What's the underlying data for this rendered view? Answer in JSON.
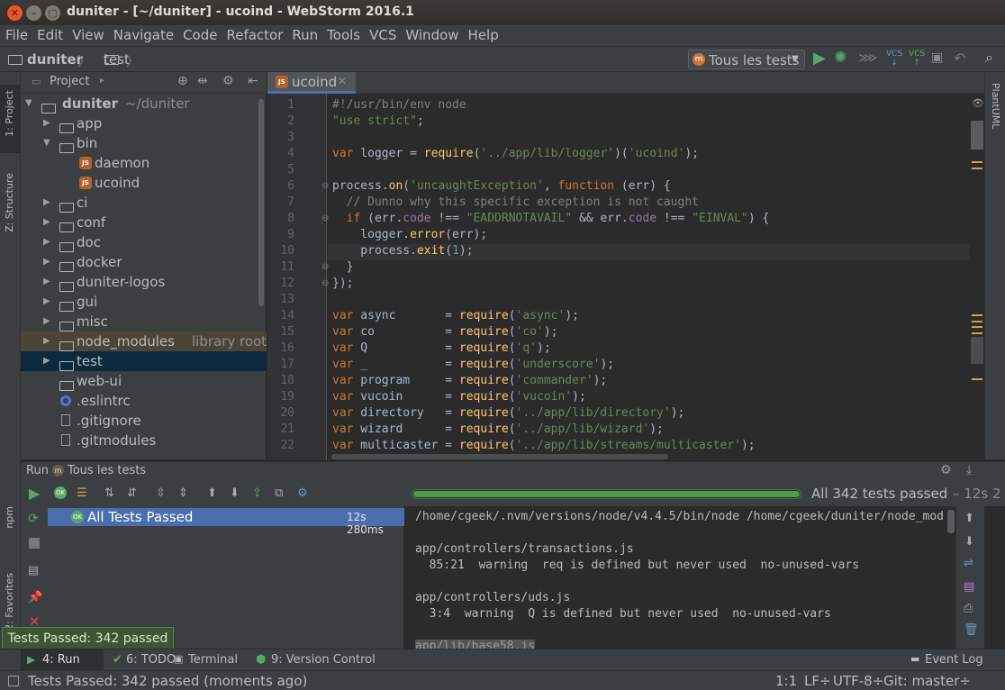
{
  "window": {
    "title": "duniter - [~/duniter] - ucoind - WebStorm 2016.1"
  },
  "menu": [
    "File",
    "Edit",
    "View",
    "Navigate",
    "Code",
    "Refactor",
    "Run",
    "Tools",
    "VCS",
    "Window",
    "Help"
  ],
  "breadcrumb": {
    "root": "duniter",
    "child": "test"
  },
  "run_config": {
    "label": "Tous les tests"
  },
  "left_tabs": {
    "project": "1: Project",
    "structure": "Z: Structure",
    "npm": "npm",
    "favorites": "2: Favorites"
  },
  "right_tabs": {
    "plantuml": "PlantUML"
  },
  "project_panel": {
    "title": "Project",
    "rows": [
      {
        "name": "duniter",
        "hint": "~/duniter"
      },
      {
        "name": "app"
      },
      {
        "name": "bin"
      },
      {
        "name": "daemon"
      },
      {
        "name": "ucoind"
      },
      {
        "name": "ci"
      },
      {
        "name": "conf"
      },
      {
        "name": "doc"
      },
      {
        "name": "docker"
      },
      {
        "name": "duniter-logos"
      },
      {
        "name": "gui"
      },
      {
        "name": "misc"
      },
      {
        "name": "node_modules",
        "hint": "library root"
      },
      {
        "name": "test"
      },
      {
        "name": "web-ui"
      },
      {
        "name": ".eslintrc"
      },
      {
        "name": ".gitignore"
      },
      {
        "name": ".gitmodules"
      }
    ]
  },
  "editor": {
    "tab": "ucoind",
    "line_numbers": [
      "1",
      "2",
      "3",
      "4",
      "5",
      "6",
      "7",
      "8",
      "9",
      "10",
      "11",
      "12",
      "13",
      "14",
      "15",
      "16",
      "17",
      "18",
      "19",
      "20",
      "21",
      "22"
    ]
  },
  "run_panel": {
    "header_label": "Run",
    "config_label": "Tous les tests",
    "summary": "All 342 tests passed",
    "duration": "– 12s 2",
    "progress": 1.0,
    "test_node": {
      "label": "All Tests Passed",
      "time": "12s 280ms"
    },
    "console_lines": [
      "/home/cgeek/.nvm/versions/node/v4.4.5/bin/node /home/cgeek/duniter/node_mod",
      "",
      "app/controllers/transactions.js",
      "  85:21  warning  req is defined but never used  no-unused-vars",
      "",
      "app/controllers/uds.js",
      "  3:4  warning  Q is defined but never used  no-unused-vars",
      "",
      "app/lib/base58.js"
    ]
  },
  "balloon": {
    "text": "Tests Passed: 342 passed"
  },
  "bottom_tabs": {
    "run": "4: Run",
    "todo": "6: TODO",
    "terminal": "Terminal",
    "vcs": "9: Version Control",
    "event_log": "Event Log"
  },
  "status": {
    "message": "Tests Passed: 342 passed (moments ago)",
    "position": "1:1",
    "line_sep": "LF÷",
    "encoding": "UTF-8÷",
    "git": "Git: master÷"
  },
  "colors": {
    "accent": "#4b6eaf",
    "selection": "#0d293e",
    "pass": "#59a869"
  }
}
